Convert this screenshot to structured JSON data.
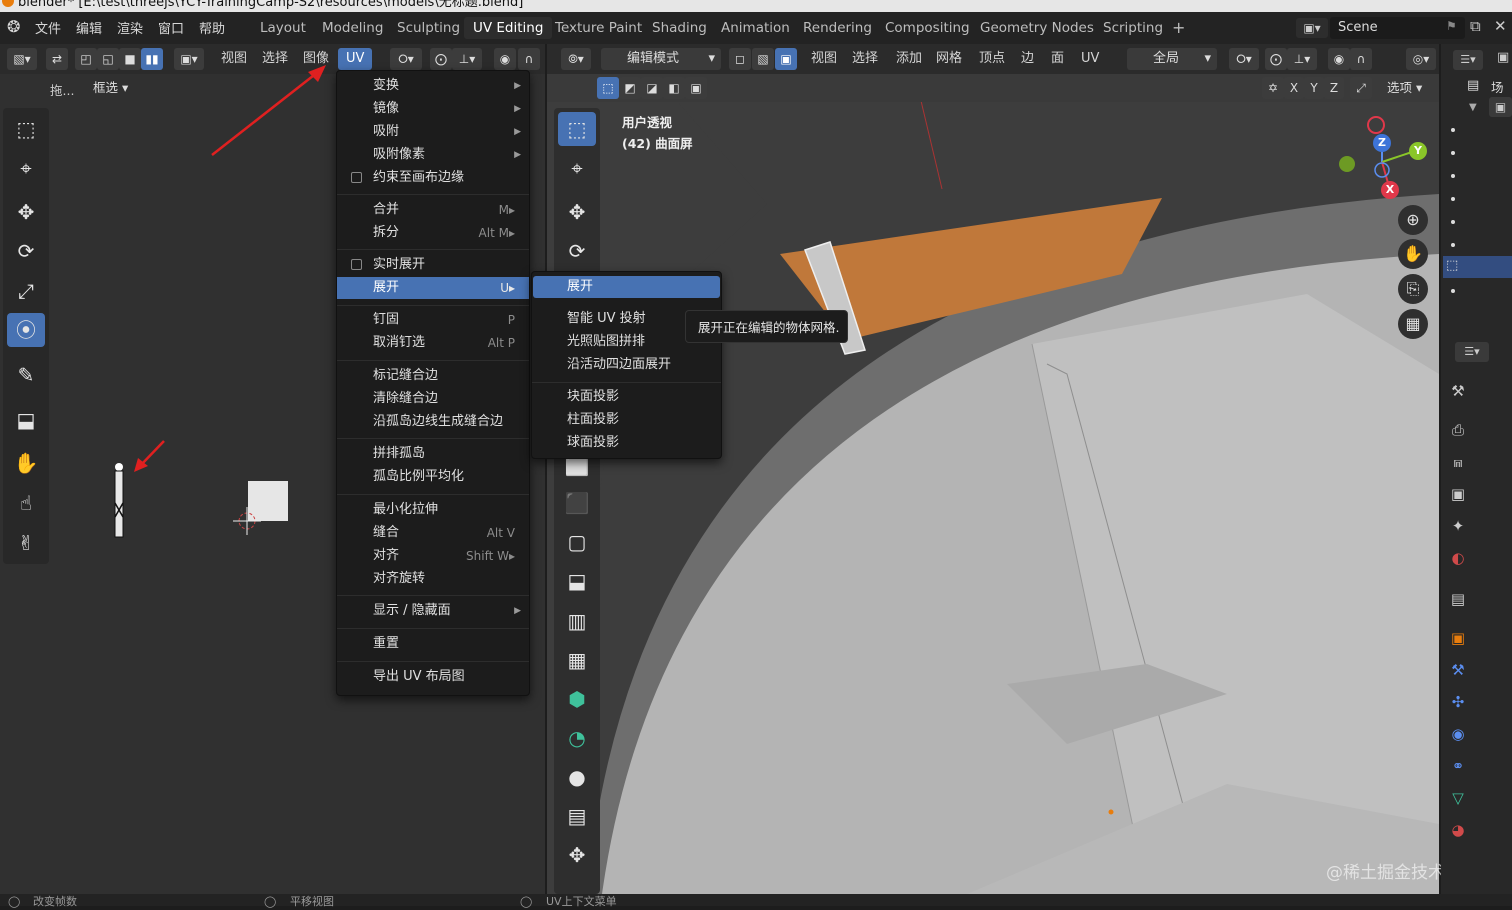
{
  "window": {
    "title": "blender* [E:\\test\\threejs\\YCY-TrainingCamp-S2\\resources\\models\\无标题.blend]"
  },
  "topmenu": {
    "file": "文件",
    "edit": "编辑",
    "render": "渲染",
    "window": "窗口",
    "help": "帮助"
  },
  "workspaces": [
    "Layout",
    "Modeling",
    "Sculpting",
    "UV Editing",
    "Texture Paint",
    "Shading",
    "Animation",
    "Rendering",
    "Compositing",
    "Geometry Nodes",
    "Scripting",
    "+"
  ],
  "scene": {
    "name": "Scene"
  },
  "uv_header": {
    "view": "视图",
    "select": "选择",
    "image": "图像",
    "uv": "UV"
  },
  "uv_sub": {
    "drag": "拖...",
    "select_mode": "框选"
  },
  "uv_menu": {
    "items": [
      {
        "label": "变换",
        "shortcut": "",
        "arrow": "▶"
      },
      {
        "label": "镜像",
        "shortcut": "",
        "arrow": "▶"
      },
      {
        "label": "吸附",
        "shortcut": "",
        "arrow": "▶"
      },
      {
        "label": "吸附像素",
        "shortcut": "",
        "arrow": "▶"
      },
      {
        "label": "约束至画布边缘",
        "shortcut": "",
        "arrow": ""
      },
      {
        "label": "合并",
        "shortcut": "M▸",
        "arrow": ""
      },
      {
        "label": "拆分",
        "shortcut": "Alt M▸",
        "arrow": ""
      },
      {
        "label": "实时展开",
        "shortcut": "",
        "arrow": ""
      },
      {
        "label": "展开",
        "shortcut": "U▸",
        "arrow": ""
      },
      {
        "label": "钉固",
        "shortcut": "P",
        "arrow": ""
      },
      {
        "label": "取消钉选",
        "shortcut": "Alt P",
        "arrow": ""
      },
      {
        "label": "标记缝合边",
        "shortcut": "",
        "arrow": ""
      },
      {
        "label": "清除缝合边",
        "shortcut": "",
        "arrow": ""
      },
      {
        "label": "沿孤岛边线生成缝合边",
        "shortcut": "",
        "arrow": ""
      },
      {
        "label": "拼排孤岛",
        "shortcut": "",
        "arrow": ""
      },
      {
        "label": "孤岛比例平均化",
        "shortcut": "",
        "arrow": ""
      },
      {
        "label": "最小化拉伸",
        "shortcut": "",
        "arrow": ""
      },
      {
        "label": "缝合",
        "shortcut": "Alt V",
        "arrow": ""
      },
      {
        "label": "对齐",
        "shortcut": "Shift W▸",
        "arrow": ""
      },
      {
        "label": "对齐旋转",
        "shortcut": "",
        "arrow": ""
      },
      {
        "label": "显示 / 隐藏面",
        "shortcut": "",
        "arrow": "▶"
      },
      {
        "label": "重置",
        "shortcut": "",
        "arrow": ""
      },
      {
        "label": "导出 UV 布局图",
        "shortcut": "",
        "arrow": ""
      }
    ]
  },
  "unwrap_submenu": {
    "items": [
      "展开",
      "智能 UV 投射",
      "光照贴图拼排",
      "沿活动四边面展开",
      "块面投影",
      "柱面投影",
      "球面投影"
    ]
  },
  "tooltip": "展开正在编辑的物体网格.",
  "viewport": {
    "edit_mode": "编辑模式",
    "view": "视图",
    "select": "选择",
    "add": "添加",
    "mesh": "网格",
    "vertex": "顶点",
    "edge": "边",
    "face": "面",
    "uv": "UV",
    "orientation": "全局",
    "options": "选项",
    "overlay_title": "用户透视",
    "overlay_object": "(42) 曲面屏"
  },
  "axes": {
    "x": "X",
    "y": "Y",
    "z": "Z"
  },
  "right_panel": {
    "label": "场"
  },
  "status": {
    "left": "改变帧数",
    "mid": "平移视图",
    "right": "UV上下文菜单"
  },
  "watermark": "@稀土掘金技术社区",
  "colors": {
    "accent": "#4772b3",
    "selected_face": "#c0783a",
    "bg_dark": "#1d1d1d"
  },
  "icons": {
    "app": "blender-logo-icon",
    "select_box": "select-box-icon",
    "cursor": "cursor-icon",
    "move": "move-icon",
    "rotate": "rotate-icon",
    "scale": "scale-icon",
    "transform": "transform-icon",
    "annotate": "annotate-icon",
    "hand": "hand-icon",
    "zoom": "zoom-icon",
    "camera": "camera-icon",
    "grid": "grid-icon"
  }
}
